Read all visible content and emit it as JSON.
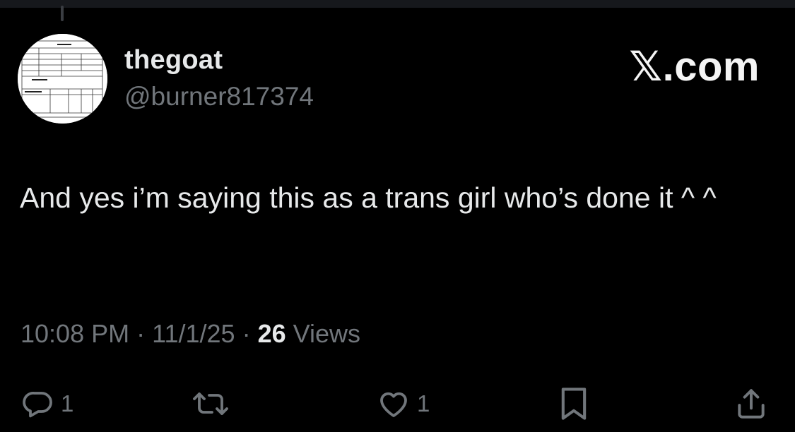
{
  "tweet": {
    "display_name": "thegoat",
    "handle": "@burner817374",
    "brand": "𝕏.com",
    "text": "And yes i’m saying this as a trans girl who’s done it ^ ^",
    "time": "10:08 PM",
    "date": "11/1/25",
    "sep": "·",
    "views_count": "26",
    "views_label": "Views"
  },
  "actions": {
    "reply_count": "1",
    "like_count": "1"
  },
  "icons": {
    "reply": "reply-icon",
    "retweet": "retweet-icon",
    "like": "heart-icon",
    "bookmark": "bookmark-icon",
    "share": "share-icon"
  },
  "colors": {
    "background": "#000000",
    "primary_text": "#e7e9ea",
    "secondary_text": "#71767b"
  }
}
